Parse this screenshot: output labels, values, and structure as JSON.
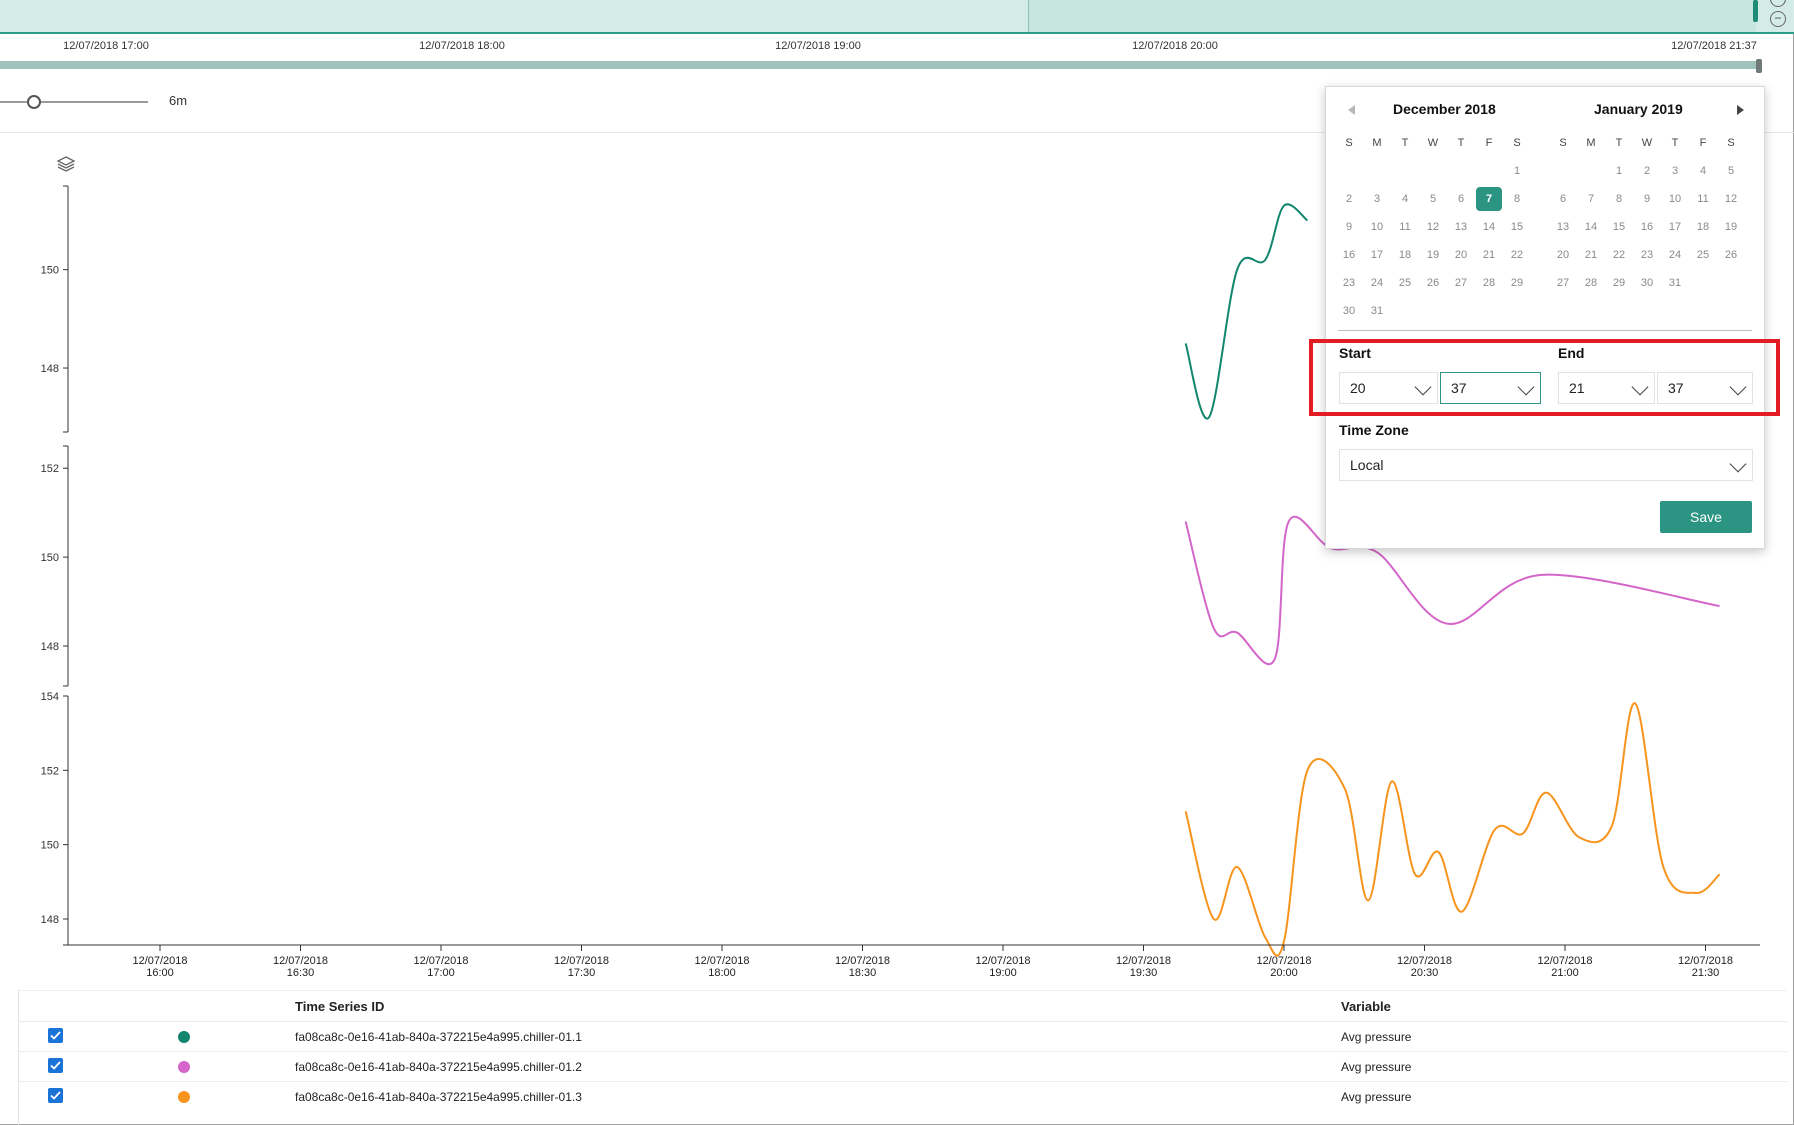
{
  "brush": {
    "ticks": [
      "12/07/2018 17:00",
      "12/07/2018 18:00",
      "12/07/2018 19:00",
      "12/07/2018 20:00",
      "12/07/2018 21:37"
    ]
  },
  "toolbar": {
    "interval_value": "6m"
  },
  "chart_data": [
    {
      "type": "line",
      "series": [
        {
          "values": [
            148.5,
            147.0,
            150.0,
            150.2,
            151.3,
            151.0
          ]
        }
      ],
      "x": [
        "19:39",
        "19:44",
        "19:50",
        "19:56",
        "20:00",
        "20:05"
      ],
      "yticks": [
        "148",
        "150"
      ],
      "color": "#13866f"
    },
    {
      "type": "line",
      "series": [
        {
          "values": [
            150.8,
            148.4,
            148.3,
            147.7,
            150.8,
            150.2,
            150.1,
            148.5,
            149.6,
            148.9
          ]
        }
      ],
      "x": [
        "19:39",
        "19:45",
        "19:50",
        "19:58",
        "20:01",
        "20:10",
        "20:20",
        "20:35",
        "20:55",
        "21:33"
      ],
      "yticks": [
        "148",
        "150",
        "152"
      ],
      "color": "#d466c9"
    },
    {
      "type": "line",
      "series": [
        {
          "values": [
            150.9,
            148.0,
            149.4,
            147.5,
            147.4,
            152.0,
            151.5,
            148.5,
            151.7,
            149.2,
            149.8,
            148.2,
            150.4,
            150.3,
            151.4,
            150.2,
            150.5,
            153.8,
            149.4,
            148.7,
            149.2
          ]
        }
      ],
      "x": [
        "19:39",
        "19:45",
        "19:50",
        "19:56",
        "20:00",
        "20:05",
        "20:13",
        "20:18",
        "20:23",
        "20:28",
        "20:33",
        "20:38",
        "20:45",
        "20:51",
        "20:56",
        "21:03",
        "21:10",
        "21:15",
        "21:21",
        "21:28",
        "21:33"
      ],
      "yticks": [
        "148",
        "150",
        "152",
        "154"
      ],
      "color": "#f7941d"
    }
  ],
  "x_axis": {
    "ticks": [
      [
        "12/07/2018",
        "16:00"
      ],
      [
        "12/07/2018",
        "16:30"
      ],
      [
        "12/07/2018",
        "17:00"
      ],
      [
        "12/07/2018",
        "17:30"
      ],
      [
        "12/07/2018",
        "18:00"
      ],
      [
        "12/07/2018",
        "18:30"
      ],
      [
        "12/07/2018",
        "19:00"
      ],
      [
        "12/07/2018",
        "19:30"
      ],
      [
        "12/07/2018",
        "20:00"
      ],
      [
        "12/07/2018",
        "20:30"
      ],
      [
        "12/07/2018",
        "21:00"
      ],
      [
        "12/07/2018",
        "21:30"
      ]
    ]
  },
  "legend": {
    "header_id": "Time Series ID",
    "header_variable": "Variable",
    "rows": [
      {
        "id": "fa08ca8c-0e16-41ab-840a-372215e4a995.chiller-01.1",
        "variable": "Avg pressure",
        "color": "#13866f",
        "checked": true
      },
      {
        "id": "fa08ca8c-0e16-41ab-840a-372215e4a995.chiller-01.2",
        "variable": "Avg pressure",
        "color": "#d466c9",
        "checked": true
      },
      {
        "id": "fa08ca8c-0e16-41ab-840a-372215e4a995.chiller-01.3",
        "variable": "Avg pressure",
        "color": "#f7941d",
        "checked": true
      }
    ]
  },
  "picker": {
    "left_month": "December 2018",
    "right_month": "January 2019",
    "weekdays": [
      "S",
      "M",
      "T",
      "W",
      "T",
      "F",
      "S"
    ],
    "left_days": [
      [
        "",
        "",
        "",
        "",
        "",
        "",
        "1"
      ],
      [
        "2",
        "3",
        "4",
        "5",
        "6",
        "7",
        "8"
      ],
      [
        "9",
        "10",
        "11",
        "12",
        "13",
        "14",
        "15"
      ],
      [
        "16",
        "17",
        "18",
        "19",
        "20",
        "21",
        "22"
      ],
      [
        "23",
        "24",
        "25",
        "26",
        "27",
        "28",
        "29"
      ],
      [
        "30",
        "31",
        "",
        "",
        "",
        "",
        ""
      ]
    ],
    "right_days": [
      [
        "",
        "",
        "1",
        "2",
        "3",
        "4",
        "5"
      ],
      [
        "6",
        "7",
        "8",
        "9",
        "10",
        "11",
        "12"
      ],
      [
        "13",
        "14",
        "15",
        "16",
        "17",
        "18",
        "19"
      ],
      [
        "20",
        "21",
        "22",
        "23",
        "24",
        "25",
        "26"
      ],
      [
        "27",
        "28",
        "29",
        "30",
        "31",
        "",
        ""
      ]
    ],
    "selected_day": "7",
    "start_label": "Start",
    "start_hour": "20",
    "start_minute": "37",
    "end_label": "End",
    "end_hour": "21",
    "end_minute": "37",
    "timezone_label": "Time Zone",
    "timezone_value": "Local",
    "save_label": "Save"
  }
}
